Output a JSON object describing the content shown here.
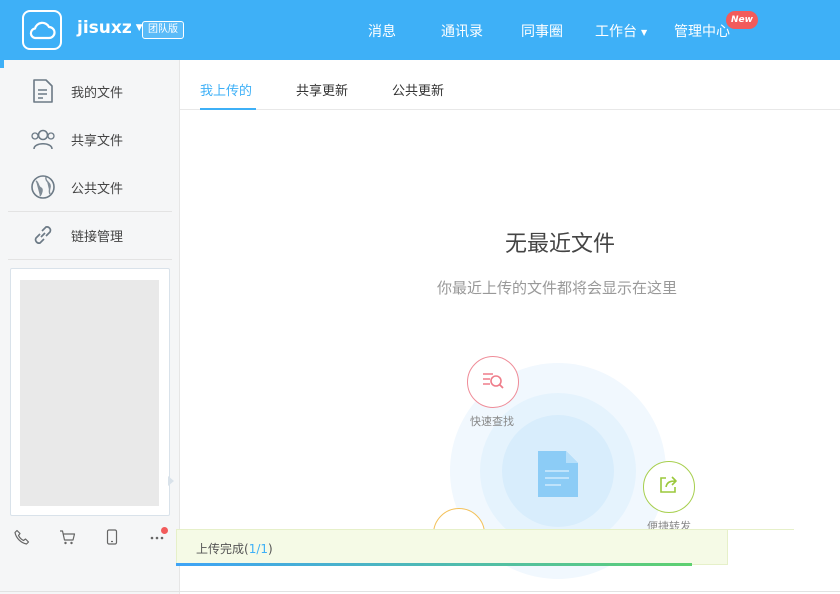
{
  "header": {
    "brand": "jisuxz",
    "edition": "团队版",
    "nav": [
      {
        "label": "消息"
      },
      {
        "label": "通讯录"
      },
      {
        "label": "同事圈"
      },
      {
        "label": "工作台"
      },
      {
        "label": "管理中心"
      }
    ],
    "new_badge": "New",
    "bg_color": "#3eb0f7"
  },
  "sidebar": {
    "items": [
      {
        "label": "我的文件",
        "icon": "document-icon"
      },
      {
        "label": "共享文件",
        "icon": "users-icon"
      },
      {
        "label": "公共文件",
        "icon": "globe-icon"
      },
      {
        "label": "链接管理",
        "icon": "link-icon"
      }
    ],
    "bottom_icons": [
      "phone-icon",
      "cart-icon",
      "mobile-icon",
      "more-icon"
    ]
  },
  "tabs": [
    {
      "label": "我上传的",
      "active": true
    },
    {
      "label": "共享更新",
      "active": false
    },
    {
      "label": "公共更新",
      "active": false
    }
  ],
  "empty_state": {
    "title": "无最近文件",
    "subtitle": "你最近上传的文件都将会显示在这里",
    "features": [
      {
        "label": "快速查找",
        "icon": "search-list-icon",
        "color": "#ef7d8a"
      },
      {
        "label": "便捷转发",
        "icon": "share-icon",
        "color": "#9bc83c"
      }
    ]
  },
  "upload": {
    "status": "上传完成(",
    "count": "1/1",
    "close": ")",
    "progress_fraction": 1
  },
  "colors": {
    "accent": "#3eb0f7",
    "badge": "#f25b5b"
  }
}
